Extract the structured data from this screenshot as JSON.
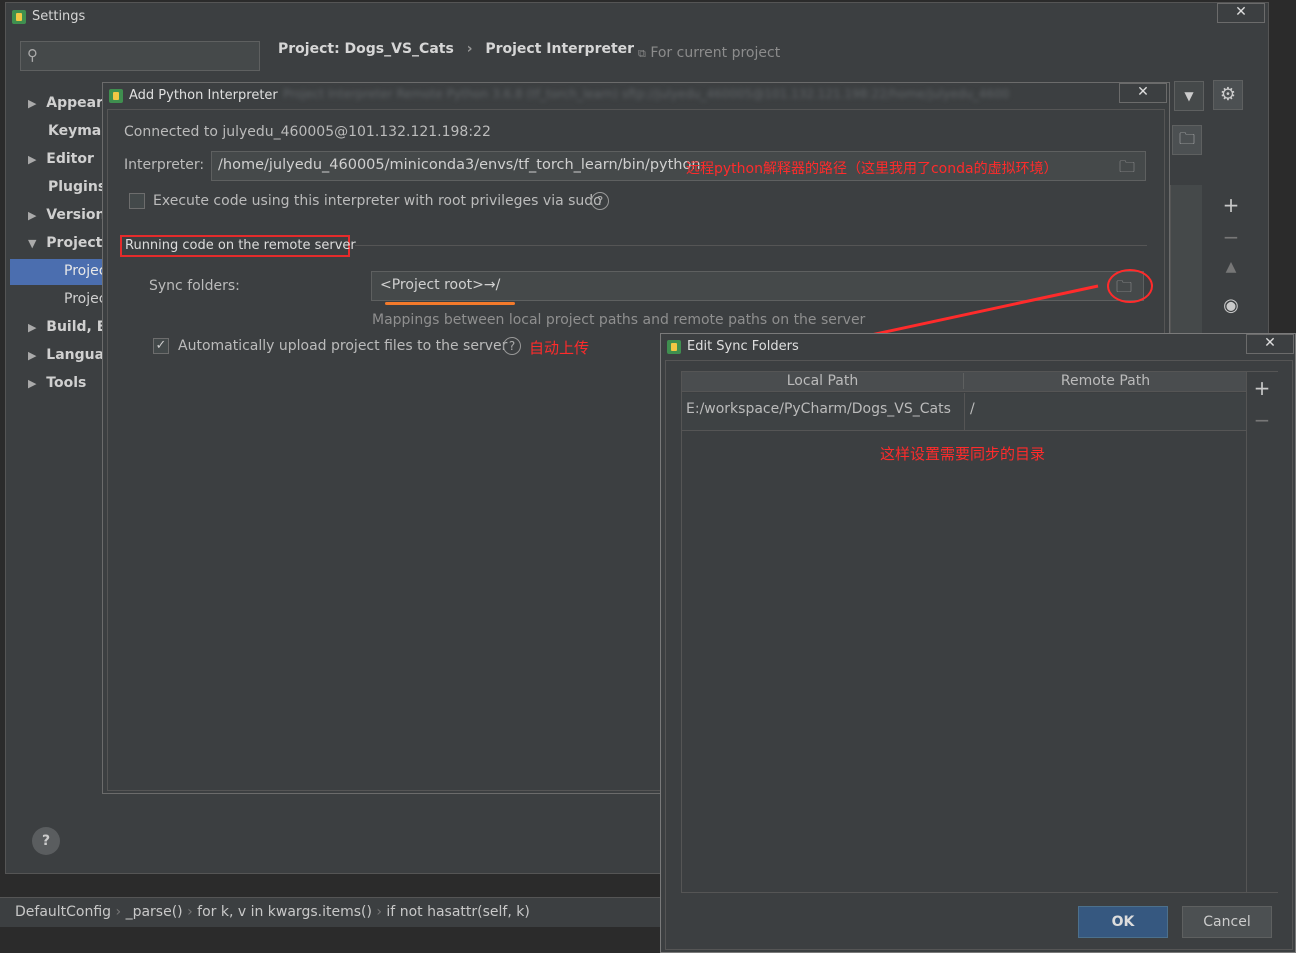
{
  "settings": {
    "title": "Settings",
    "search_placeholder": "",
    "breadcrumb": {
      "project": "Project: Dogs_VS_Cats",
      "separator": "›",
      "page": "Project Interpreter"
    },
    "for_current_project": "For current project",
    "tree": [
      {
        "label": "Appeara",
        "arrow": "▶"
      },
      {
        "label": "Keymap",
        "arrow": ""
      },
      {
        "label": "Editor",
        "arrow": "▶"
      },
      {
        "label": "Plugins",
        "arrow": ""
      },
      {
        "label": "Version",
        "arrow": "▶"
      },
      {
        "label": "Project:",
        "arrow": "▼"
      },
      {
        "label": "Projec",
        "arrow": ""
      },
      {
        "label": "Projec",
        "arrow": ""
      },
      {
        "label": "Build, E",
        "arrow": "▶"
      },
      {
        "label": "Languag",
        "arrow": "▶"
      },
      {
        "label": "Tools",
        "arrow": "▶"
      }
    ],
    "help_label": "?"
  },
  "add_interpreter": {
    "title": "Add Python Interpreter",
    "blurred_header": "Project Interpreter   Remote Python 3.6.8 (tf_torch_learn)  sftp://julyedu_460005@101.132.121.198:22/home/julyedu_4600",
    "connected": "Connected to julyedu_460005@101.132.121.198:22",
    "interpreter_label": "Interpreter:",
    "interpreter_value": "/home/julyedu_460005/miniconda3/envs/tf_torch_learn/bin/python",
    "interpreter_note": "远程python解释器的路径（这里我用了conda的虚拟环境）",
    "sudo_label": "Execute code using this interpreter with root privileges via sudo",
    "section_label": "Running code on the remote server",
    "sync_label": "Sync folders:",
    "sync_value": "<Project root>→/",
    "mapping_hint": "Mappings between local project paths and remote paths on the server",
    "auto_upload_label": "Automatically upload project files to the server",
    "auto_upload_note": "自动上传"
  },
  "edit_sync": {
    "title": "Edit Sync Folders",
    "columns": [
      "Local Path",
      "Remote Path"
    ],
    "rows": [
      {
        "local": "E:/workspace/PyCharm/Dogs_VS_Cats",
        "remote": "/"
      }
    ],
    "note": "这样设置需要同步的目录",
    "ok": "OK",
    "cancel": "Cancel"
  },
  "statusbar": {
    "crumbs": [
      "DefaultConfig",
      "_parse()",
      "for k, v in kwargs.items()",
      "if not hasattr(self, k)"
    ],
    "sep": "›"
  },
  "colors": {
    "accent": "#4b6eaf",
    "annotation": "#ff2b2b",
    "background": "#3c3f41"
  }
}
